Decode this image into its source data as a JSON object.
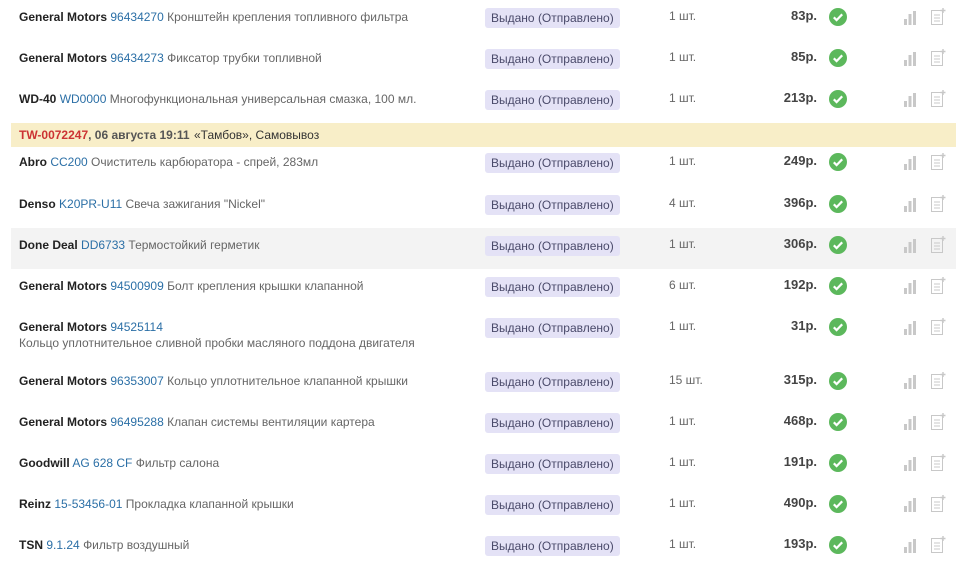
{
  "accent": {
    "ok_green": "#5cb85c",
    "badge_bg": "#e4e2f6",
    "order_bg": "#f8eec8",
    "order_num": "#cc3333",
    "link": "#2b6fa6"
  },
  "icons": {
    "ok": "check-circle-icon",
    "stats": "bar-chart-icon",
    "note": "add-note-icon"
  },
  "group1": [
    {
      "brand": "General Motors",
      "article": "96434270",
      "name": "Кронштейн крепления топливного фильтра",
      "status": "Выдано (Отправлено)",
      "qty": "1 шт.",
      "price": "83р."
    },
    {
      "brand": "General Motors",
      "article": "96434273",
      "name": "Фиксатор трубки топливной",
      "status": "Выдано (Отправлено)",
      "qty": "1 шт.",
      "price": "85р."
    },
    {
      "brand": "WD-40",
      "article": "WD0000",
      "name": "Многофункциональная универсальная смазка, 100 мл.",
      "status": "Выдано (Отправлено)",
      "qty": "1 шт.",
      "price": "213р."
    }
  ],
  "order": {
    "number": "TW-0072247",
    "date": ", 06 августа 19:11",
    "shop": "«Тамбов», Самовывоз"
  },
  "group2": [
    {
      "brand": "Abro",
      "article": "CC200",
      "name": "Очиститель карбюратора - спрей, 283мл",
      "status": "Выдано (Отправлено)",
      "qty": "1 шт.",
      "price": "249р."
    },
    {
      "brand": "Denso",
      "article": "K20PR-U11",
      "name": "Свеча зажигания \"Nickel\"",
      "status": "Выдано (Отправлено)",
      "qty": "4 шт.",
      "price": "396р."
    },
    {
      "brand": "Done Deal",
      "article": "DD6733",
      "name": "Термостойкий герметик",
      "status": "Выдано (Отправлено)",
      "qty": "1 шт.",
      "price": "306р."
    },
    {
      "brand": "General Motors",
      "article": "94500909",
      "name": "Болт крепления крышки клапанной",
      "status": "Выдано (Отправлено)",
      "qty": "6 шт.",
      "price": "192р."
    },
    {
      "brand": "General Motors",
      "article": "94525114",
      "name": "Кольцо уплотнительное сливной пробки масляного поддона двигателя",
      "status": "Выдано (Отправлено)",
      "qty": "1 шт.",
      "price": "31р."
    },
    {
      "brand": "General Motors",
      "article": "96353007",
      "name": "Кольцо уплотнительное клапанной крышки",
      "status": "Выдано (Отправлено)",
      "qty": "15 шт.",
      "price": "315р."
    },
    {
      "brand": "General Motors",
      "article": "96495288",
      "name": "Клапан системы вентиляции картера",
      "status": "Выдано (Отправлено)",
      "qty": "1 шт.",
      "price": "468р."
    },
    {
      "brand": "Goodwill",
      "article": "AG 628 CF",
      "name": "Фильтр салона",
      "status": "Выдано (Отправлено)",
      "qty": "1 шт.",
      "price": "191р."
    },
    {
      "brand": "Reinz",
      "article": "15-53456-01",
      "name": "Прокладка клапанной крышки",
      "status": "Выдано (Отправлено)",
      "qty": "1 шт.",
      "price": "490р."
    },
    {
      "brand": "TSN",
      "article": "9.1.24",
      "name": "Фильтр воздушный",
      "status": "Выдано (Отправлено)",
      "qty": "1 шт.",
      "price": "193р."
    }
  ]
}
